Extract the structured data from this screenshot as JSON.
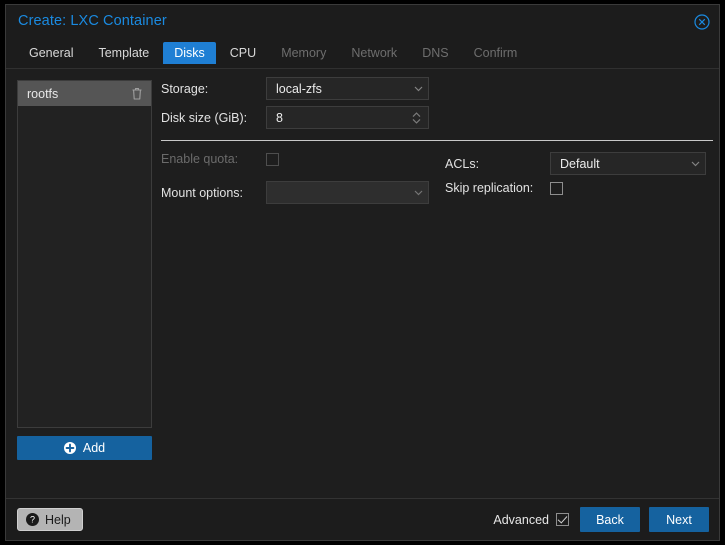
{
  "window": {
    "title": "Create: LXC Container",
    "close_icon": "close-circle-icon"
  },
  "tabs": [
    {
      "label": "General",
      "state": "normal"
    },
    {
      "label": "Template",
      "state": "normal"
    },
    {
      "label": "Disks",
      "state": "active"
    },
    {
      "label": "CPU",
      "state": "normal"
    },
    {
      "label": "Memory",
      "state": "dim"
    },
    {
      "label": "Network",
      "state": "dim"
    },
    {
      "label": "DNS",
      "state": "dim"
    },
    {
      "label": "Confirm",
      "state": "dim"
    }
  ],
  "disk_list": {
    "items": [
      {
        "label": "rootfs",
        "selected": true,
        "delete_icon": "trash-icon"
      }
    ],
    "add_label": "Add",
    "add_icon": "plus-circle-icon"
  },
  "form": {
    "storage": {
      "label": "Storage:",
      "value": "local-zfs",
      "icon": "chevron-down-icon"
    },
    "disk_size": {
      "label": "Disk size (GiB):",
      "value": "8",
      "icon": "spinner-updown-icon"
    },
    "enable_quota": {
      "label": "Enable quota:",
      "checked": false,
      "disabled": true
    },
    "mount_options": {
      "label": "Mount options:",
      "value": "",
      "icon": "chevron-down-icon"
    },
    "acls": {
      "label": "ACLs:",
      "value": "Default",
      "icon": "chevron-down-icon"
    },
    "skip_replication": {
      "label": "Skip replication:",
      "checked": false,
      "disabled": false
    }
  },
  "footer": {
    "help_label": "Help",
    "help_icon": "question-circle-icon",
    "advanced_label": "Advanced",
    "advanced_checked": true,
    "back_label": "Back",
    "next_label": "Next"
  },
  "colors": {
    "accent_blue": "#1f7fd4",
    "button_blue": "#15629f",
    "title_blue": "#1a8ae0",
    "window_bg": "#1c1c1c",
    "body_bg": "#1e1e1e"
  }
}
